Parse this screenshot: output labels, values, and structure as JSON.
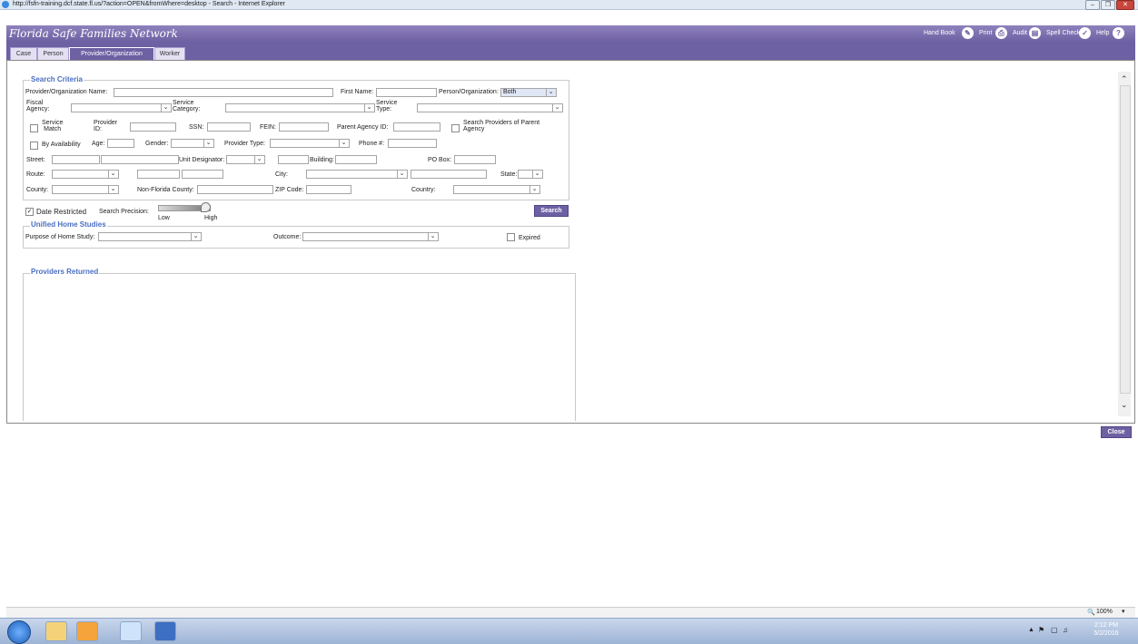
{
  "window": {
    "title": "http://fsfn-training.dcf.state.fl.us/?action=OPEN&fromWhere=desktop - Search - Internet Explorer",
    "controls": [
      "–",
      "❐",
      "✕"
    ]
  },
  "header": {
    "brand": "Florida Safe Families Network",
    "links": [
      {
        "label": "Hand Book",
        "icon": "pencil-icon",
        "glyph": "✎"
      },
      {
        "label": "Print",
        "icon": "print-icon",
        "glyph": "⎙"
      },
      {
        "label": "Audit",
        "icon": "audit-icon",
        "glyph": "▤"
      },
      {
        "label": "Spell Check",
        "icon": "spell-check-icon",
        "glyph": "✓"
      },
      {
        "label": "Help",
        "icon": "help-icon",
        "glyph": "?"
      }
    ]
  },
  "tabs": [
    {
      "label": "Case",
      "active": false
    },
    {
      "label": "Person",
      "active": false
    },
    {
      "label": "Provider/Organization",
      "active": true
    },
    {
      "label": "Worker",
      "active": false
    }
  ],
  "search": {
    "legend": "Search Criteria",
    "provider_org_name": {
      "label": "Provider/Organization Name:",
      "value": ""
    },
    "first_name": {
      "label": "First Name:",
      "value": ""
    },
    "person_org": {
      "label": "Person/Organization:",
      "value": "Both"
    },
    "fiscal_agency": {
      "label1": "Fiscal",
      "label2": "Agency:",
      "value": ""
    },
    "service_category": {
      "label1": "Service",
      "label2": "Category:",
      "value": ""
    },
    "service_type": {
      "label1": "Service",
      "label2": "Type:",
      "value": ""
    },
    "service_match": {
      "label1": "Service",
      "label2": "Match",
      "checked": false
    },
    "provider_id": {
      "label1": "Provider",
      "label2": "ID:",
      "value": ""
    },
    "ssn": {
      "label": "SSN:",
      "value": ""
    },
    "fein": {
      "label": "FEIN:",
      "value": ""
    },
    "parent_agency_id": {
      "label": "Parent Agency ID:",
      "value": ""
    },
    "search_providers_parent": {
      "label1": "Search Providers of Parent",
      "label2": "Agency",
      "checked": false
    },
    "by_availability": {
      "label": "By Availability",
      "checked": false
    },
    "age": {
      "label": "Age:",
      "value": ""
    },
    "gender": {
      "label": "Gender:",
      "value": ""
    },
    "provider_type": {
      "label": "Provider Type:",
      "value": ""
    },
    "phone": {
      "label": "Phone #:",
      "value": ""
    },
    "street": {
      "label": "Street:",
      "value": ""
    },
    "unit_designator": {
      "label": "Unit Designator:",
      "value": ""
    },
    "building": {
      "label": "Building:",
      "value": ""
    },
    "po_box": {
      "label": "PO Box:",
      "value": ""
    },
    "route": {
      "label": "Route:",
      "value": ""
    },
    "city": {
      "label": "City:",
      "value": ""
    },
    "state": {
      "label": "State:",
      "value": ""
    },
    "county": {
      "label": "County:",
      "value": ""
    },
    "non_florida_county": {
      "label": "Non-Florida County:",
      "value": ""
    },
    "zip": {
      "label": "ZIP Code:",
      "value": ""
    },
    "country": {
      "label": "Country:",
      "value": ""
    },
    "date_restricted": {
      "label": "Date Restricted",
      "checked": true
    },
    "search_precision": {
      "label": "Search Precision:",
      "low": "Low",
      "high": "High",
      "level": 1.0
    },
    "search_button": "Search"
  },
  "home_studies": {
    "legend": "Unified Home Studies",
    "purpose": {
      "label": "Purpose of Home Study:",
      "value": ""
    },
    "outcome": {
      "label": "Outcome:",
      "value": ""
    },
    "expired": {
      "label": "Expired",
      "checked": false
    }
  },
  "results": {
    "legend": "Providers Returned"
  },
  "close_button": "Close",
  "status": {
    "zoom": "100%"
  },
  "taskbar": {
    "time": "2:12 PM",
    "date": "5/2/2016",
    "apps": [
      "start-orb-icon",
      "file-explorer-icon",
      "outlook-icon",
      "internet-explorer-icon",
      "word-icon"
    ]
  }
}
